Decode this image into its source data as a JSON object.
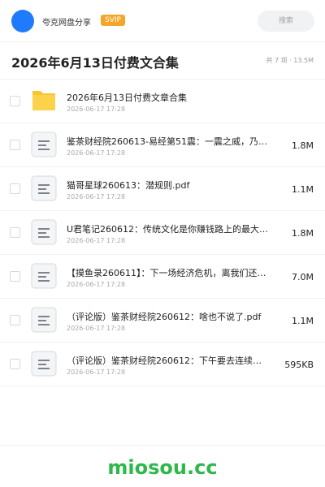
{
  "header": {
    "username": "夸克网盘分享",
    "badge": "SVIP",
    "search_placeholder": "搜索"
  },
  "title": "2026年6月13日付费文合集",
  "summary": "共 7 项 · 13.5M",
  "colors": {
    "accent": "#1f7bfb",
    "badge": "#f7a52a",
    "watermark": "#2eb84b",
    "folder": "#f9c52f"
  },
  "items": [
    {
      "name": "2026年6月13日付费文章合集",
      "date": "2026-06-17 17:28",
      "size": "",
      "icon": "folder-icon"
    },
    {
      "name": "鉴茶财经院260613-易经第51震：一震之威，乃…",
      "date": "2026-06-17 17:28",
      "size": "1.8M",
      "icon": "document-icon"
    },
    {
      "name": "猫哥星球260613：潜规则.pdf",
      "date": "2026-06-17 17:28",
      "size": "1.1M",
      "icon": "document-icon"
    },
    {
      "name": "U君笔记260612：传统文化是你赚钱路上的最大障…",
      "date": "2026-06-17 17:28",
      "size": "1.8M",
      "icon": "document-icon"
    },
    {
      "name": "【摸鱼录260611】：下一场经济危机，离我们还有…",
      "date": "2026-06-17 17:28",
      "size": "7.0M",
      "icon": "document-icon"
    },
    {
      "name": "（评论版）鉴茶财经院260612：啥也不说了.pdf",
      "date": "2026-06-17 17:28",
      "size": "1.1M",
      "icon": "document-icon"
    },
    {
      "name": "（评论版）鉴茶财经院260612：下午要去连续考察…",
      "date": "2026-06-17 17:28",
      "size": "595KB",
      "icon": "document-icon"
    }
  ],
  "watermark": "miosou.cc"
}
